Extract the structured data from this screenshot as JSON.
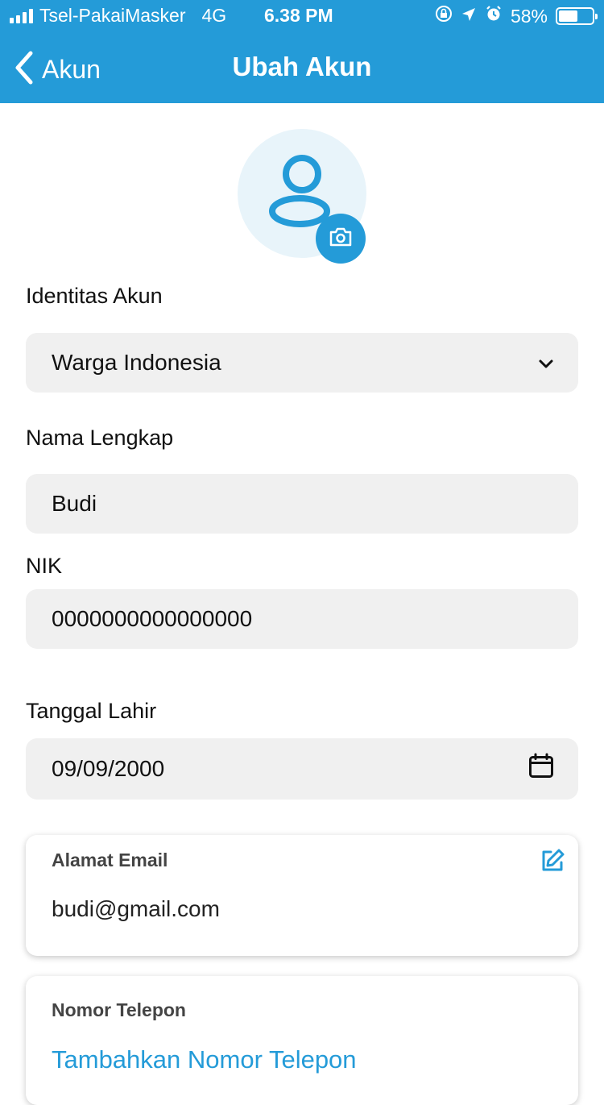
{
  "status_bar": {
    "carrier": "Tsel-PakaiMasker",
    "network": "4G",
    "time": "6.38 PM",
    "battery_percent": "58%",
    "battery_level": 0.58
  },
  "nav": {
    "back_label": "Akun",
    "title": "Ubah Akun"
  },
  "form": {
    "identity": {
      "label": "Identitas Akun",
      "value": "Warga Indonesia"
    },
    "name": {
      "label": "Nama Lengkap",
      "value": "Budi"
    },
    "nik": {
      "label": "NIK",
      "value": "0000000000000000"
    },
    "birth_date": {
      "label": "Tanggal Lahir",
      "value": "09/09/2000"
    }
  },
  "email_card": {
    "title": "Alamat Email",
    "value": "budi@gmail.com"
  },
  "phone_card": {
    "title": "Nomor Telepon",
    "action": "Tambahkan Nomor Telepon"
  },
  "colors": {
    "primary": "#249bd8",
    "field_bg": "#f0f0f0",
    "avatar_bg": "#e8f4fa"
  },
  "icons": [
    "back-chevron-icon",
    "user-icon",
    "camera-icon",
    "chevron-down-icon",
    "calendar-icon",
    "edit-icon",
    "signal-icon",
    "orientation-lock-icon",
    "location-icon",
    "alarm-icon",
    "battery-icon"
  ]
}
